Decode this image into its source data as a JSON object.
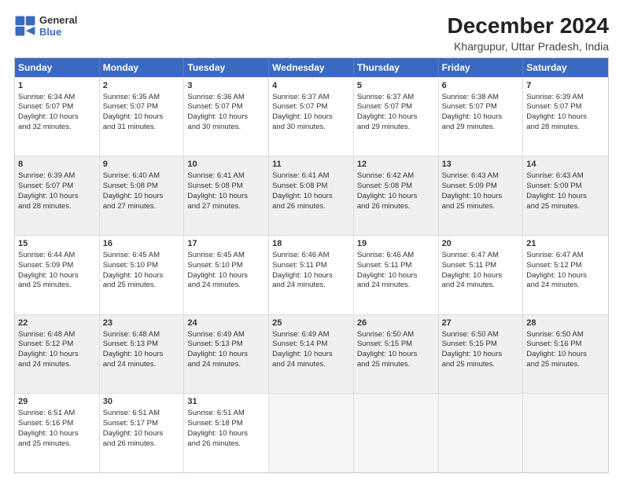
{
  "logo": {
    "line1": "General",
    "line2": "Blue"
  },
  "title": "December 2024",
  "subtitle": "Khargupur, Uttar Pradesh, India",
  "header_days": [
    "Sunday",
    "Monday",
    "Tuesday",
    "Wednesday",
    "Thursday",
    "Friday",
    "Saturday"
  ],
  "weeks": [
    [
      {
        "day": "1",
        "lines": [
          "Sunrise: 6:34 AM",
          "Sunset: 5:07 PM",
          "Daylight: 10 hours",
          "and 32 minutes."
        ],
        "shaded": false
      },
      {
        "day": "2",
        "lines": [
          "Sunrise: 6:35 AM",
          "Sunset: 5:07 PM",
          "Daylight: 10 hours",
          "and 31 minutes."
        ],
        "shaded": false
      },
      {
        "day": "3",
        "lines": [
          "Sunrise: 6:36 AM",
          "Sunset: 5:07 PM",
          "Daylight: 10 hours",
          "and 30 minutes."
        ],
        "shaded": false
      },
      {
        "day": "4",
        "lines": [
          "Sunrise: 6:37 AM",
          "Sunset: 5:07 PM",
          "Daylight: 10 hours",
          "and 30 minutes."
        ],
        "shaded": false
      },
      {
        "day": "5",
        "lines": [
          "Sunrise: 6:37 AM",
          "Sunset: 5:07 PM",
          "Daylight: 10 hours",
          "and 29 minutes."
        ],
        "shaded": false
      },
      {
        "day": "6",
        "lines": [
          "Sunrise: 6:38 AM",
          "Sunset: 5:07 PM",
          "Daylight: 10 hours",
          "and 29 minutes."
        ],
        "shaded": false
      },
      {
        "day": "7",
        "lines": [
          "Sunrise: 6:39 AM",
          "Sunset: 5:07 PM",
          "Daylight: 10 hours",
          "and 28 minutes."
        ],
        "shaded": false
      }
    ],
    [
      {
        "day": "8",
        "lines": [
          "Sunrise: 6:39 AM",
          "Sunset: 5:07 PM",
          "Daylight: 10 hours",
          "and 28 minutes."
        ],
        "shaded": true
      },
      {
        "day": "9",
        "lines": [
          "Sunrise: 6:40 AM",
          "Sunset: 5:08 PM",
          "Daylight: 10 hours",
          "and 27 minutes."
        ],
        "shaded": true
      },
      {
        "day": "10",
        "lines": [
          "Sunrise: 6:41 AM",
          "Sunset: 5:08 PM",
          "Daylight: 10 hours",
          "and 27 minutes."
        ],
        "shaded": true
      },
      {
        "day": "11",
        "lines": [
          "Sunrise: 6:41 AM",
          "Sunset: 5:08 PM",
          "Daylight: 10 hours",
          "and 26 minutes."
        ],
        "shaded": true
      },
      {
        "day": "12",
        "lines": [
          "Sunrise: 6:42 AM",
          "Sunset: 5:08 PM",
          "Daylight: 10 hours",
          "and 26 minutes."
        ],
        "shaded": true
      },
      {
        "day": "13",
        "lines": [
          "Sunrise: 6:43 AM",
          "Sunset: 5:09 PM",
          "Daylight: 10 hours",
          "and 25 minutes."
        ],
        "shaded": true
      },
      {
        "day": "14",
        "lines": [
          "Sunrise: 6:43 AM",
          "Sunset: 5:09 PM",
          "Daylight: 10 hours",
          "and 25 minutes."
        ],
        "shaded": true
      }
    ],
    [
      {
        "day": "15",
        "lines": [
          "Sunrise: 6:44 AM",
          "Sunset: 5:09 PM",
          "Daylight: 10 hours",
          "and 25 minutes."
        ],
        "shaded": false
      },
      {
        "day": "16",
        "lines": [
          "Sunrise: 6:45 AM",
          "Sunset: 5:10 PM",
          "Daylight: 10 hours",
          "and 25 minutes."
        ],
        "shaded": false
      },
      {
        "day": "17",
        "lines": [
          "Sunrise: 6:45 AM",
          "Sunset: 5:10 PM",
          "Daylight: 10 hours",
          "and 24 minutes."
        ],
        "shaded": false
      },
      {
        "day": "18",
        "lines": [
          "Sunrise: 6:46 AM",
          "Sunset: 5:11 PM",
          "Daylight: 10 hours",
          "and 24 minutes."
        ],
        "shaded": false
      },
      {
        "day": "19",
        "lines": [
          "Sunrise: 6:46 AM",
          "Sunset: 5:11 PM",
          "Daylight: 10 hours",
          "and 24 minutes."
        ],
        "shaded": false
      },
      {
        "day": "20",
        "lines": [
          "Sunrise: 6:47 AM",
          "Sunset: 5:11 PM",
          "Daylight: 10 hours",
          "and 24 minutes."
        ],
        "shaded": false
      },
      {
        "day": "21",
        "lines": [
          "Sunrise: 6:47 AM",
          "Sunset: 5:12 PM",
          "Daylight: 10 hours",
          "and 24 minutes."
        ],
        "shaded": false
      }
    ],
    [
      {
        "day": "22",
        "lines": [
          "Sunrise: 6:48 AM",
          "Sunset: 5:12 PM",
          "Daylight: 10 hours",
          "and 24 minutes."
        ],
        "shaded": true
      },
      {
        "day": "23",
        "lines": [
          "Sunrise: 6:48 AM",
          "Sunset: 5:13 PM",
          "Daylight: 10 hours",
          "and 24 minutes."
        ],
        "shaded": true
      },
      {
        "day": "24",
        "lines": [
          "Sunrise: 6:49 AM",
          "Sunset: 5:13 PM",
          "Daylight: 10 hours",
          "and 24 minutes."
        ],
        "shaded": true
      },
      {
        "day": "25",
        "lines": [
          "Sunrise: 6:49 AM",
          "Sunset: 5:14 PM",
          "Daylight: 10 hours",
          "and 24 minutes."
        ],
        "shaded": true
      },
      {
        "day": "26",
        "lines": [
          "Sunrise: 6:50 AM",
          "Sunset: 5:15 PM",
          "Daylight: 10 hours",
          "and 25 minutes."
        ],
        "shaded": true
      },
      {
        "day": "27",
        "lines": [
          "Sunrise: 6:50 AM",
          "Sunset: 5:15 PM",
          "Daylight: 10 hours",
          "and 25 minutes."
        ],
        "shaded": true
      },
      {
        "day": "28",
        "lines": [
          "Sunrise: 6:50 AM",
          "Sunset: 5:16 PM",
          "Daylight: 10 hours",
          "and 25 minutes."
        ],
        "shaded": true
      }
    ],
    [
      {
        "day": "29",
        "lines": [
          "Sunrise: 6:51 AM",
          "Sunset: 5:16 PM",
          "Daylight: 10 hours",
          "and 25 minutes."
        ],
        "shaded": false
      },
      {
        "day": "30",
        "lines": [
          "Sunrise: 6:51 AM",
          "Sunset: 5:17 PM",
          "Daylight: 10 hours",
          "and 26 minutes."
        ],
        "shaded": false
      },
      {
        "day": "31",
        "lines": [
          "Sunrise: 6:51 AM",
          "Sunset: 5:18 PM",
          "Daylight: 10 hours",
          "and 26 minutes."
        ],
        "shaded": false
      },
      {
        "day": "",
        "lines": [],
        "shaded": false,
        "empty": true
      },
      {
        "day": "",
        "lines": [],
        "shaded": false,
        "empty": true
      },
      {
        "day": "",
        "lines": [],
        "shaded": false,
        "empty": true
      },
      {
        "day": "",
        "lines": [],
        "shaded": false,
        "empty": true
      }
    ]
  ]
}
